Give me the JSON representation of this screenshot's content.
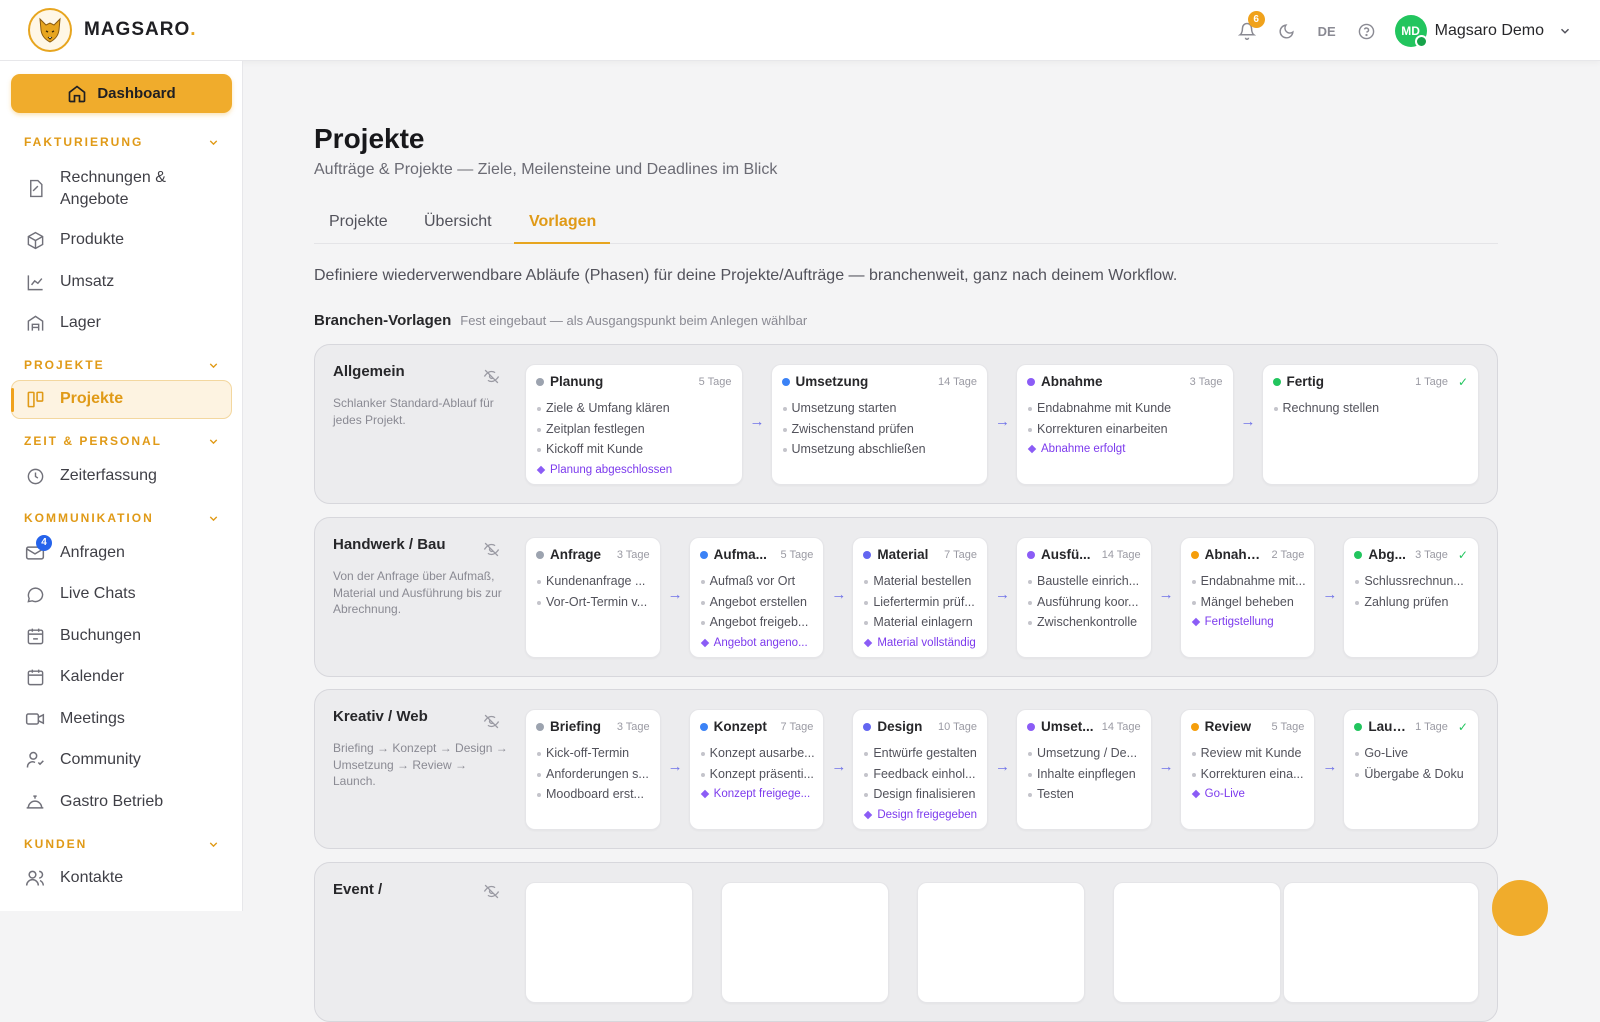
{
  "brand": {
    "name": "MAGSARO",
    "dot": "."
  },
  "topbar": {
    "notification_count": "6",
    "language": "DE",
    "user_initials": "MD",
    "user_name": "Magsaro Demo"
  },
  "sidebar": {
    "dashboard": "Dashboard",
    "sections": {
      "fakturierung": "FAKTURIERUNG",
      "projekte": "PROJEKTE",
      "zeit": "ZEIT & PERSONAL",
      "kommunikation": "KOMMUNIKATION",
      "kunden": "KUNDEN"
    },
    "items": {
      "rechnungen_1": "Rechnungen &",
      "rechnungen_2": "Angebote",
      "produkte": "Produkte",
      "umsatz": "Umsatz",
      "lager": "Lager",
      "projekte": "Projekte",
      "zeiterfassung": "Zeiterfassung",
      "anfragen": "Anfragen",
      "anfragen_badge": "4",
      "live_chats": "Live Chats",
      "buchungen": "Buchungen",
      "kalender": "Kalender",
      "meetings": "Meetings",
      "community": "Community",
      "gastro": "Gastro Betrieb",
      "kontakte": "Kontakte"
    }
  },
  "page": {
    "title": "Projekte",
    "subtitle": "Aufträge & Projekte — Ziele, Meilensteine und Deadlines im Blick",
    "tabs": [
      "Projekte",
      "Übersicht",
      "Vorlagen"
    ],
    "active_tab": "Vorlagen",
    "intro": "Definiere wiederverwendbare Abläufe (Phasen) für deine Projekte/Aufträge — branchenweit, ganz nach deinem Workflow.",
    "branchen_title": "Branchen-Vorlagen",
    "branchen_sub": "Fest eingebaut — als Ausgangspunkt beim Anlegen wählbar"
  },
  "templates": [
    {
      "title": "Allgemein",
      "desc": "Schlanker Standard-Ablauf für jedes Projekt.",
      "phases": [
        {
          "name": "Planung",
          "days": "5 Tage",
          "color": "#9ca3af",
          "items": [
            "Ziele & Umfang klären",
            "Zeitplan festlegen",
            "Kickoff mit Kunde"
          ],
          "milestone": "Planung abgeschlossen"
        },
        {
          "name": "Umsetzung",
          "days": "14 Tage",
          "color": "#3b82f6",
          "items": [
            "Umsetzung starten",
            "Zwischenstand prüfen",
            "Umsetzung abschließen"
          ],
          "milestone": ""
        },
        {
          "name": "Abnahme",
          "days": "3 Tage",
          "color": "#8b5cf6",
          "items": [
            "Endabnahme mit Kunde",
            "Korrekturen einarbeiten"
          ],
          "milestone": "Abnahme erfolgt"
        },
        {
          "name": "Fertig",
          "days": "1 Tage",
          "color": "#22c55e",
          "items": [
            "Rechnung stellen"
          ],
          "milestone": "",
          "check": "✓"
        }
      ]
    },
    {
      "title": "Handwerk / Bau",
      "desc": "Von der Anfrage über Aufmaß, Material und Ausführung bis zur Abrechnung.",
      "phases": [
        {
          "name": "Anfrage",
          "days": "3 Tage",
          "color": "#9ca3af",
          "items": [
            "Kundenanfrage ...",
            "Vor-Ort-Termin v..."
          ],
          "milestone": ""
        },
        {
          "name": "Aufma...",
          "days": "5 Tage",
          "color": "#3b82f6",
          "items": [
            "Aufmaß vor Ort",
            "Angebot erstellen",
            "Angebot freigeb..."
          ],
          "milestone": "Angebot angeno..."
        },
        {
          "name": "Material",
          "days": "7 Tage",
          "color": "#6366f1",
          "items": [
            "Material bestellen",
            "Liefertermin prüf...",
            "Material einlagern"
          ],
          "milestone": "Material vollständig"
        },
        {
          "name": "Ausfü...",
          "days": "14 Tage",
          "color": "#8b5cf6",
          "items": [
            "Baustelle einrich...",
            "Ausführung koor...",
            "Zwischenkontrolle"
          ],
          "milestone": ""
        },
        {
          "name": "Abnahme",
          "days": "2 Tage",
          "color": "#f59e0b",
          "items": [
            "Endabnahme mit...",
            "Mängel beheben"
          ],
          "milestone": "Fertigstellung"
        },
        {
          "name": "Abg...",
          "days": "3 Tage",
          "color": "#22c55e",
          "items": [
            "Schlussrechnun...",
            "Zahlung prüfen"
          ],
          "milestone": "",
          "check": "✓"
        }
      ]
    },
    {
      "title": "Kreativ / Web",
      "desc": "Briefing → Konzept → Design → Umsetzung → Review → Launch.",
      "phases": [
        {
          "name": "Briefing",
          "days": "3 Tage",
          "color": "#9ca3af",
          "items": [
            "Kick-off-Termin",
            "Anforderungen s...",
            "Moodboard erst..."
          ],
          "milestone": ""
        },
        {
          "name": "Konzept",
          "days": "7 Tage",
          "color": "#3b82f6",
          "items": [
            "Konzept ausarbe...",
            "Konzept präsenti..."
          ],
          "milestone": "Konzept freigege..."
        },
        {
          "name": "Design",
          "days": "10 Tage",
          "color": "#6366f1",
          "items": [
            "Entwürfe gestalten",
            "Feedback einhol...",
            "Design finalisieren"
          ],
          "milestone": "Design freigegeben"
        },
        {
          "name": "Umset...",
          "days": "14 Tage",
          "color": "#8b5cf6",
          "items": [
            "Umsetzung / De...",
            "Inhalte einpflegen",
            "Testen"
          ],
          "milestone": ""
        },
        {
          "name": "Review",
          "days": "5 Tage",
          "color": "#f59e0b",
          "items": [
            "Review mit Kunde",
            "Korrekturen eina..."
          ],
          "milestone": "Go-Live"
        },
        {
          "name": "Laun...",
          "days": "1 Tage",
          "color": "#22c55e",
          "items": [
            "Go-Live",
            "Übergabe & Doku"
          ],
          "milestone": "",
          "check": "✓"
        }
      ]
    },
    {
      "title": "Event /",
      "desc": "",
      "phases": []
    }
  ]
}
